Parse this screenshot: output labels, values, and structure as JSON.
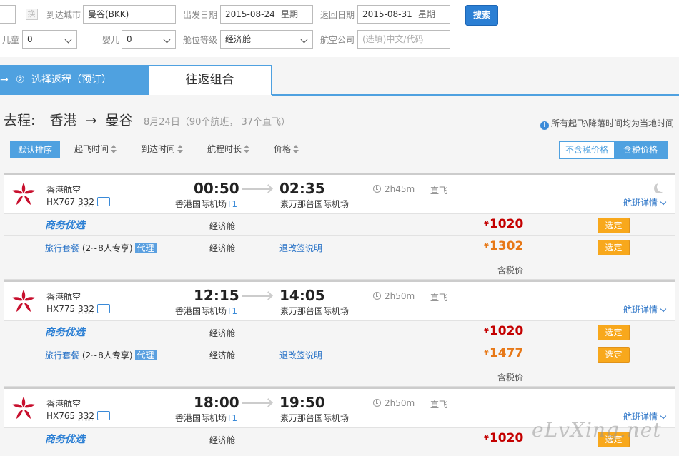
{
  "search": {
    "swap_label": "换",
    "to_city_label": "到达城市",
    "to_city_value": "曼谷(BKK)",
    "depart_label": "出发日期",
    "depart_date": "2015-08-24",
    "depart_weekday": "星期一",
    "return_label": "返回日期",
    "return_date": "2015-08-31",
    "return_weekday": "星期一",
    "search_button": "搜索",
    "child_label": "儿童",
    "child_value": "0",
    "infant_label": "婴儿",
    "infant_value": "0",
    "cabin_label": "舱位等级",
    "cabin_value": "经济舱",
    "airline_label": "航空公司",
    "airline_placeholder": "(选填)中文/代码"
  },
  "steps": {
    "step1_arrow": "→",
    "step1_num": "②",
    "step1_label": "选择返程（预订）",
    "step2_label": "往返组合"
  },
  "route": {
    "label": "去程:",
    "from": "香港",
    "arrow": "→",
    "to": "曼谷",
    "summary": "8月24日（90个航班， 37个直飞）",
    "timezone_note": "所有起飞\\降落时间均为当地时间"
  },
  "sort": {
    "default": "默认排序",
    "items": [
      "起飞时间",
      "到达时间",
      "航程时长",
      "价格"
    ],
    "tax_exclusive": "不含税价格",
    "tax_inclusive": "含税价格"
  },
  "flights": [
    {
      "airline": "香港航空",
      "flight_no": "HX767",
      "aircraft": "332",
      "dep_time": "00:50",
      "arr_time": "02:35",
      "dep_airport": "香港国际机场",
      "dep_terminal": "T1",
      "arr_airport": "素万那普国际机场",
      "duration": "2h45m",
      "stops": "直飞",
      "detail": "航班详情",
      "biz_label": "商务优选",
      "biz_cabin": "经济舱",
      "biz_price": "1020",
      "pkg_label": "旅行套餐",
      "pkg_sub": "(2~8人专享)",
      "pkg_tag": "代理",
      "pkg_cabin": "经济舱",
      "pkg_rules": "退改签说明",
      "pkg_price": "1302",
      "select": "选定",
      "tax_note": "含税价"
    },
    {
      "airline": "香港航空",
      "flight_no": "HX775",
      "aircraft": "332",
      "dep_time": "12:15",
      "arr_time": "14:05",
      "dep_airport": "香港国际机场",
      "dep_terminal": "T1",
      "arr_airport": "素万那普国际机场",
      "duration": "2h50m",
      "stops": "直飞",
      "detail": "航班详情",
      "biz_label": "商务优选",
      "biz_cabin": "经济舱",
      "biz_price": "1020",
      "pkg_label": "旅行套餐",
      "pkg_sub": "(2~8人专享)",
      "pkg_tag": "代理",
      "pkg_cabin": "经济舱",
      "pkg_rules": "退改签说明",
      "pkg_price": "1477",
      "select": "选定",
      "tax_note": "含税价"
    },
    {
      "airline": "香港航空",
      "flight_no": "HX765",
      "aircraft": "332",
      "dep_time": "18:00",
      "arr_time": "19:50",
      "dep_airport": "香港国际机场",
      "dep_terminal": "T1",
      "arr_airport": "素万那普国际机场",
      "duration": "2h50m",
      "stops": "直飞",
      "detail": "航班详情",
      "biz_label": "商务优选",
      "biz_cabin": "经济舱",
      "biz_price": "1020",
      "select": "选定"
    }
  ],
  "currency": "¥",
  "watermark": "eLvXing.net",
  "colors": {
    "accent_blue": "#4fa1e0",
    "price_red": "#c40000",
    "price_orange": "#e77817",
    "select_orange": "#f8a81c",
    "logo_red": "#c8102e"
  }
}
